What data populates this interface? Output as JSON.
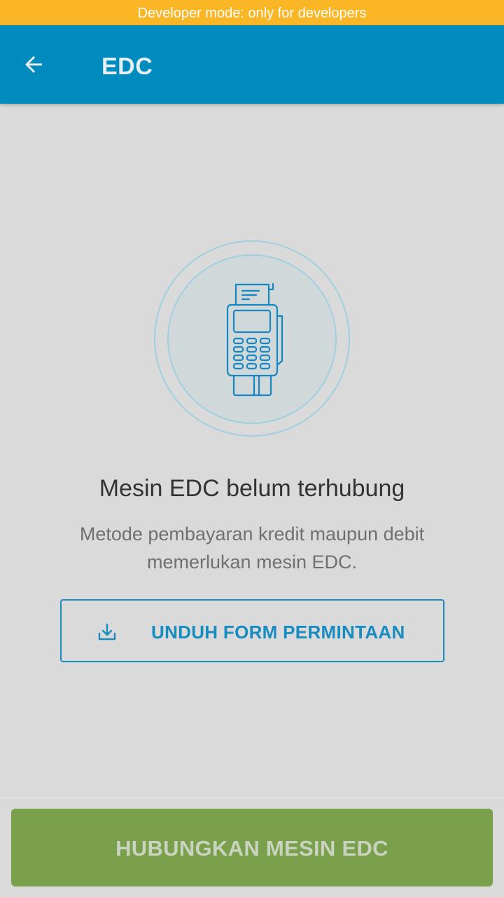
{
  "banner": {
    "text": "Developer mode: only for developers"
  },
  "app_bar": {
    "title": "EDC",
    "back_icon": "arrow-left-icon"
  },
  "empty_state": {
    "illustration_icon": "edc-machine-icon",
    "headline": "Mesin EDC belum terhubung",
    "description": "Metode pembayaran kredit maupun debit memerlukan mesin EDC.",
    "download_button": {
      "icon": "download-icon",
      "label": "UNDUH FORM PERMINTAAN"
    }
  },
  "footer": {
    "connect_button_label": "HUBUNGKAN MESIN EDC"
  },
  "colors": {
    "banner": "#fbb626",
    "app_bar": "#008bbf",
    "accent": "#178cc1",
    "primary_button": "#7ba04b",
    "background": "#dadada"
  }
}
